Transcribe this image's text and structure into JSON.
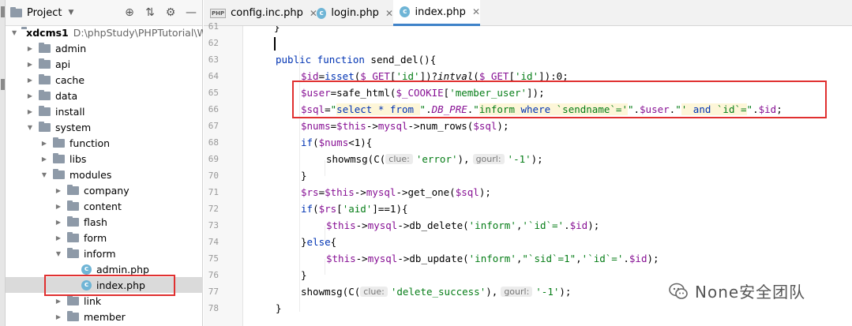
{
  "project_panel": {
    "title": "Project",
    "root": {
      "name": "xdcms1",
      "path": "D:\\phpStudy\\PHPTutorial\\W"
    },
    "items": [
      {
        "label": "admin",
        "type": "folder",
        "depth": 1,
        "expanded": false
      },
      {
        "label": "api",
        "type": "folder",
        "depth": 1,
        "expanded": false
      },
      {
        "label": "cache",
        "type": "folder",
        "depth": 1,
        "expanded": false
      },
      {
        "label": "data",
        "type": "folder",
        "depth": 1,
        "expanded": false
      },
      {
        "label": "install",
        "type": "folder",
        "depth": 1,
        "expanded": false
      },
      {
        "label": "system",
        "type": "folder",
        "depth": 1,
        "expanded": true
      },
      {
        "label": "function",
        "type": "folder",
        "depth": 2,
        "expanded": false
      },
      {
        "label": "libs",
        "type": "folder",
        "depth": 2,
        "expanded": false
      },
      {
        "label": "modules",
        "type": "folder",
        "depth": 2,
        "expanded": true
      },
      {
        "label": "company",
        "type": "folder",
        "depth": 3,
        "expanded": false
      },
      {
        "label": "content",
        "type": "folder",
        "depth": 3,
        "expanded": false
      },
      {
        "label": "flash",
        "type": "folder",
        "depth": 3,
        "expanded": false
      },
      {
        "label": "form",
        "type": "folder",
        "depth": 3,
        "expanded": false
      },
      {
        "label": "inform",
        "type": "folder",
        "depth": 3,
        "expanded": true
      },
      {
        "label": "admin.php",
        "type": "file",
        "depth": 4
      },
      {
        "label": "index.php",
        "type": "file",
        "depth": 4,
        "selected": true
      },
      {
        "label": "link",
        "type": "folder",
        "depth": 3,
        "expanded": false
      },
      {
        "label": "member",
        "type": "folder",
        "depth": 3,
        "expanded": false
      }
    ]
  },
  "tabs": [
    {
      "label": "config.inc.php",
      "icon": "php-file-icon",
      "icon_text": "PHP",
      "active": false
    },
    {
      "label": "login.php",
      "icon": "class-file-icon",
      "icon_text": "c",
      "active": false
    },
    {
      "label": "index.php",
      "icon": "class-file-icon",
      "icon_text": "c",
      "active": true
    }
  ],
  "code": {
    "line_numbers": [
      "61",
      "62",
      "63",
      "64",
      "65",
      "66",
      "67",
      "68",
      "69",
      "70",
      "71",
      "72",
      "73",
      "74",
      "75",
      "76",
      "77",
      "78"
    ],
    "hints": {
      "clue": "clue:",
      "gourl": "gourl:"
    }
  },
  "watermark": "None安全团队",
  "colors": {
    "highlight_box": "#e03030",
    "active_tab": "#4083c9",
    "keyword": "#0033b3",
    "variable": "#871094",
    "string": "#067d17"
  }
}
